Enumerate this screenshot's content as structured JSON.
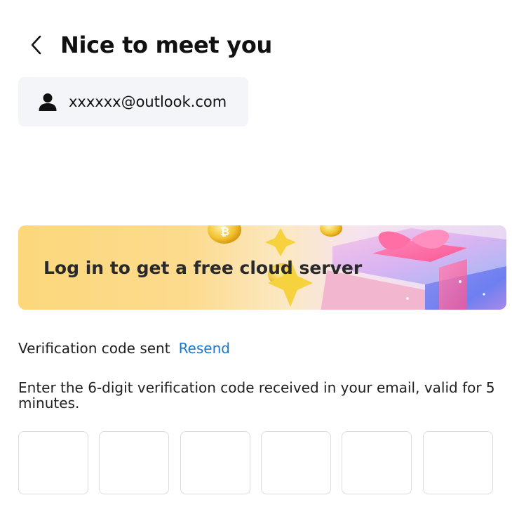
{
  "header": {
    "title": "Nice to meet you",
    "back_icon": "chevron-left-icon"
  },
  "account": {
    "icon": "user-icon",
    "email": "xxxxxx@outlook.com"
  },
  "promo_banner": {
    "text": "Log in to get a free cloud server",
    "art": [
      "gold-coin-icon",
      "sparkle-star-icon",
      "gift-box-icon"
    ]
  },
  "verification": {
    "status_text": "Verification code sent",
    "resend_label": "Resend",
    "instruction": "Enter the 6-digit verification code received in your email, valid for 5 minutes.",
    "code_values": [
      "",
      "",
      "",
      "",
      "",
      ""
    ]
  },
  "colors": {
    "accent_link": "#1677d2",
    "chip_background": "#f4f5f9",
    "input_border": "#dcdcdc"
  }
}
